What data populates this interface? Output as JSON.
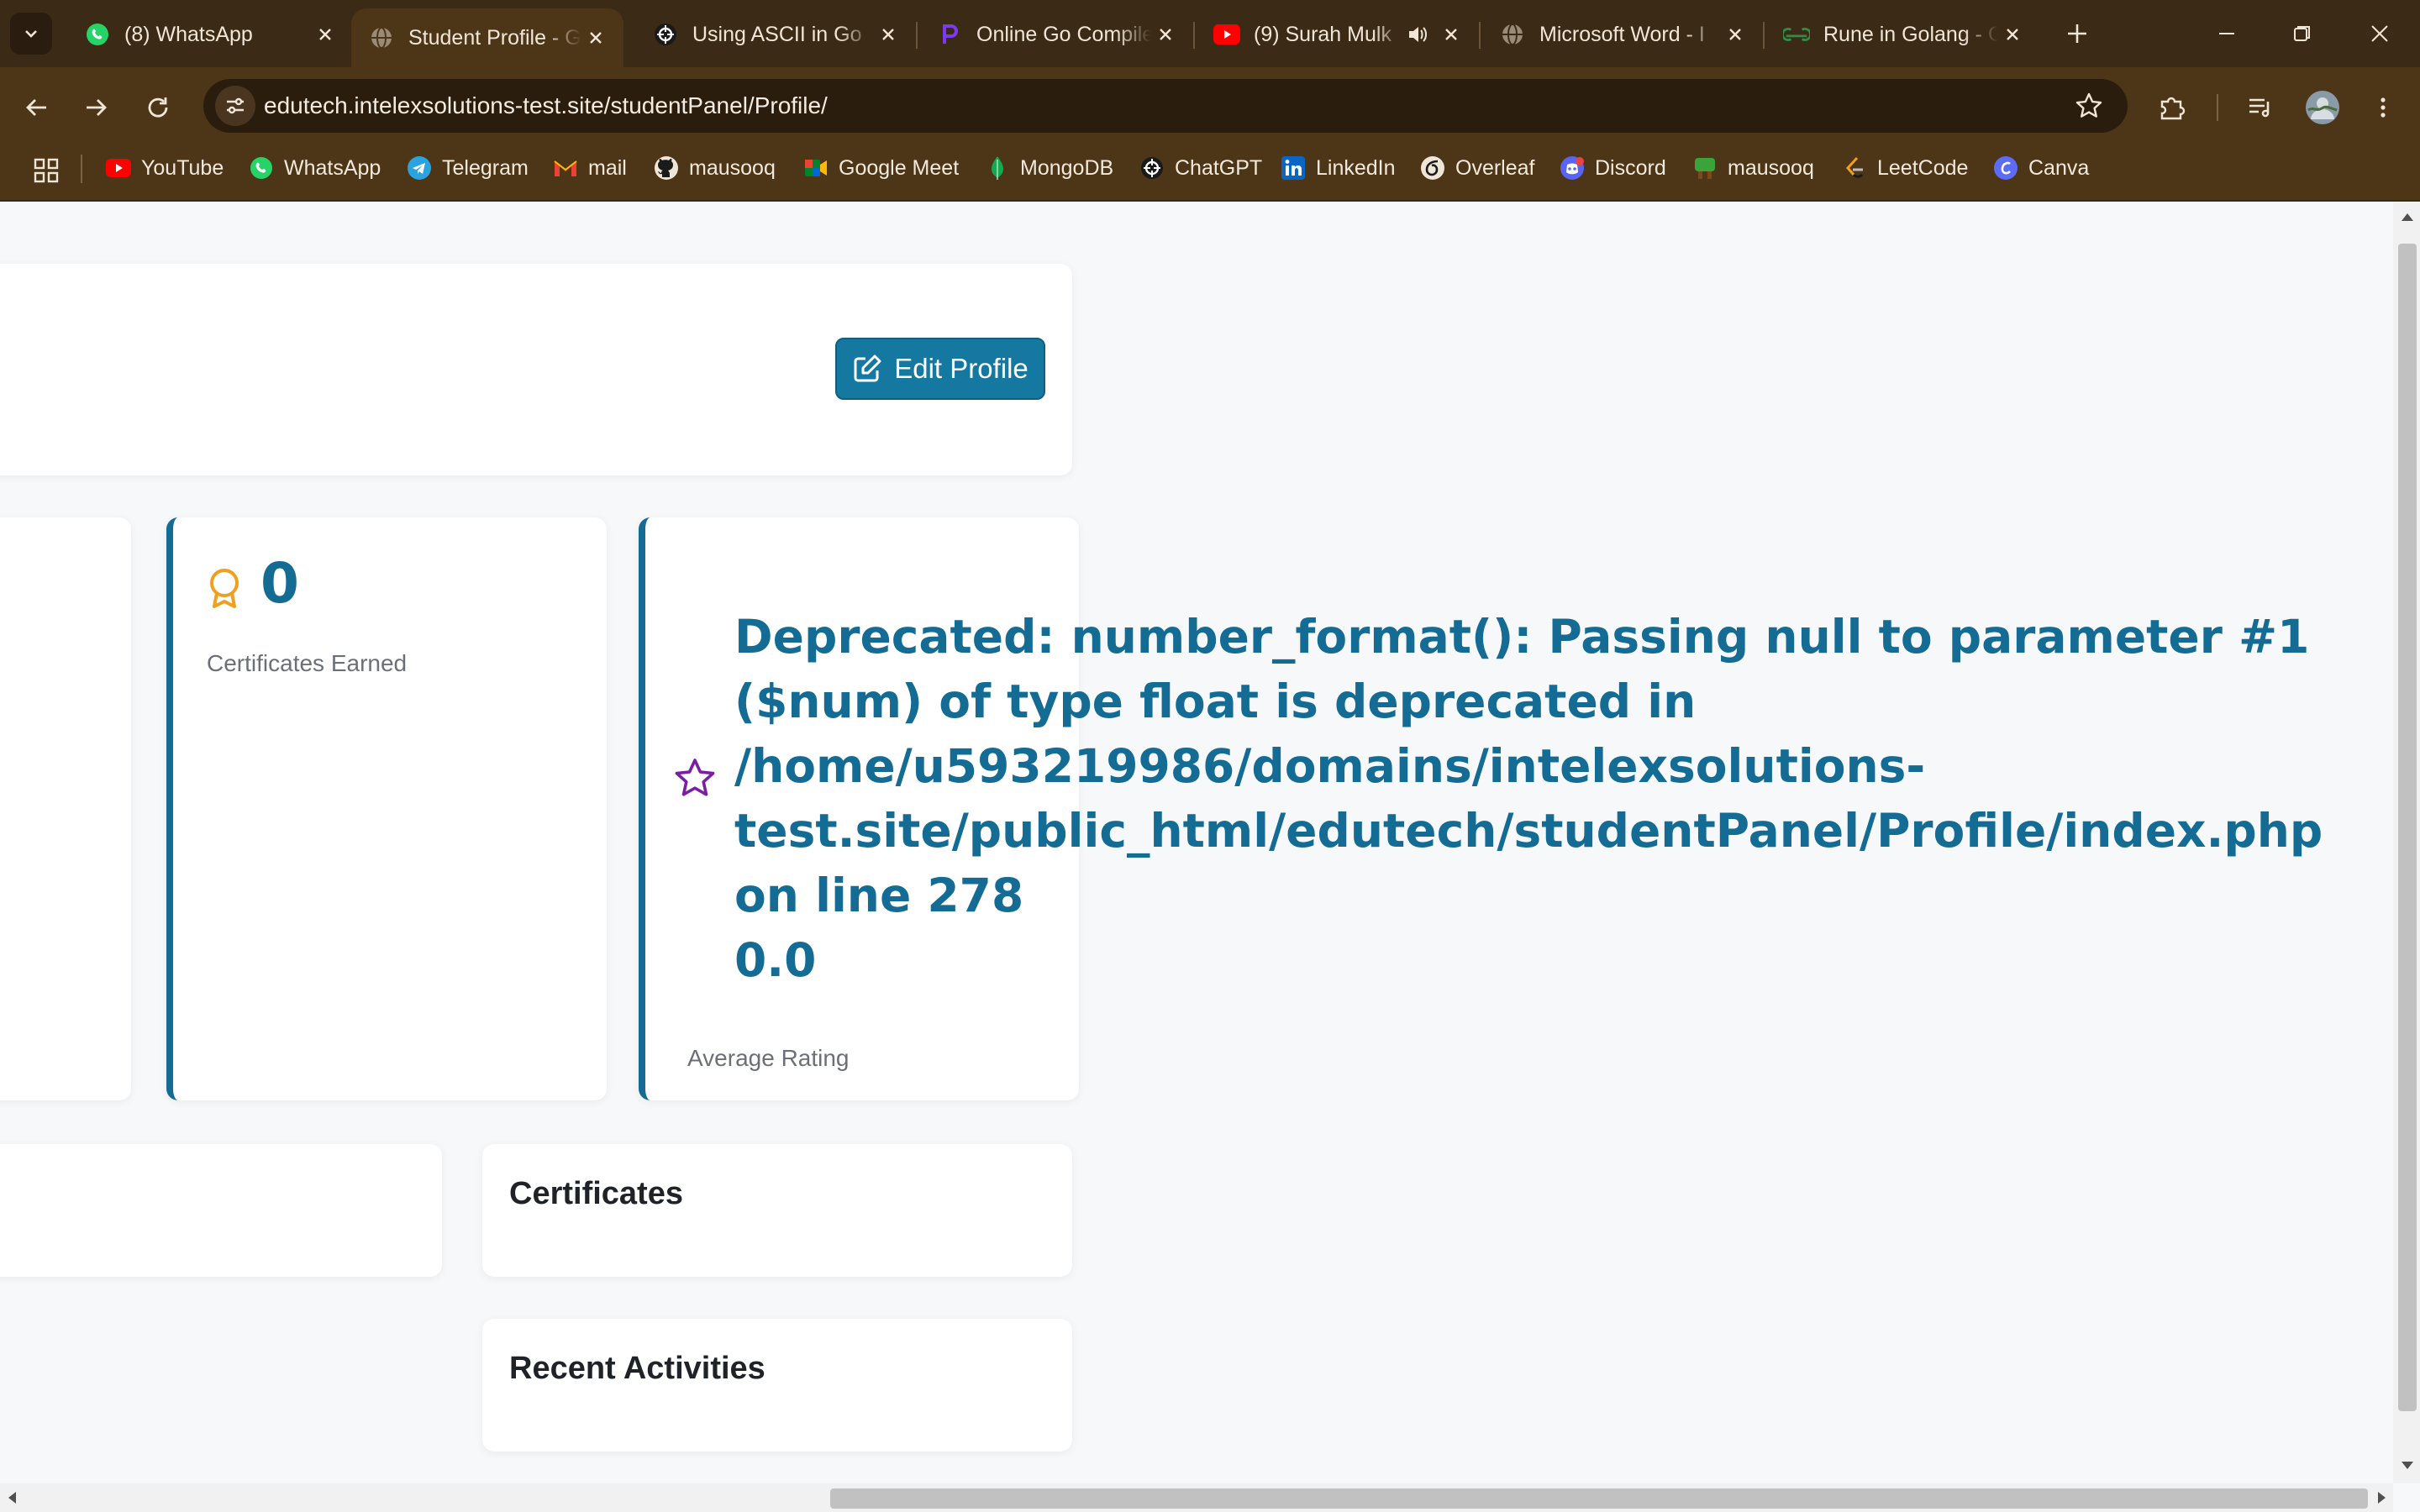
{
  "browser": {
    "tabs": [
      {
        "title": "(8) WhatsApp",
        "icon": "whatsapp-icon",
        "active": false
      },
      {
        "title": "Student Profile - G",
        "icon": "globe-icon",
        "active": true
      },
      {
        "title": "Using ASCII in Go",
        "icon": "chatgpt-icon",
        "active": false
      },
      {
        "title": "Online Go Compile",
        "icon": "programiz-icon",
        "active": false
      },
      {
        "title": "(9) Surah Mulk",
        "icon": "youtube-icon",
        "active": false
      },
      {
        "title": "Microsoft Word - I",
        "icon": "globe-icon",
        "active": false
      },
      {
        "title": "Rune in Golang - G",
        "icon": "geeksforgeeks-icon",
        "active": false
      }
    ],
    "url": "edutech.intelexsolutions-test.site/studentPanel/Profile/",
    "bookmarks": [
      {
        "label": "YouTube",
        "icon": "youtube-icon"
      },
      {
        "label": "WhatsApp",
        "icon": "whatsapp-icon"
      },
      {
        "label": "Telegram",
        "icon": "telegram-icon"
      },
      {
        "label": "mail",
        "icon": "gmail-icon"
      },
      {
        "label": "mausooq",
        "icon": "github-icon"
      },
      {
        "label": "Google Meet",
        "icon": "google-meet-icon"
      },
      {
        "label": "MongoDB",
        "icon": "mongodb-icon"
      },
      {
        "label": "ChatGPT",
        "icon": "chatgpt-icon"
      },
      {
        "label": "LinkedIn",
        "icon": "linkedin-icon"
      },
      {
        "label": "Overleaf",
        "icon": "overleaf-icon"
      },
      {
        "label": "Discord",
        "icon": "discord-icon"
      },
      {
        "label": "mausooq",
        "icon": "tree-icon"
      },
      {
        "label": "LeetCode",
        "icon": "leetcode-icon"
      },
      {
        "label": "Canva",
        "icon": "canva-icon"
      }
    ]
  },
  "page": {
    "edit_profile_label": "Edit Profile",
    "certificates": {
      "value": "0",
      "label": "Certificates Earned"
    },
    "rating": {
      "deprecation_label": "Deprecated",
      "deprecation_lines": [
        ": number_format(): Passing null to parameter #1",
        "($num) of type float is deprecated in",
        "/home/u593219986/domains/intelexsolutions-",
        "test.site/public_html/edutech/studentPanel/Profile/index.php",
        "on line 278"
      ],
      "value": "0.0",
      "label": "Average Rating"
    },
    "sections": {
      "certificates_title": "Certificates",
      "recent_activities_title": "Recent Activities"
    }
  },
  "colors": {
    "accent": "#146b93",
    "button": "#1478a1",
    "award_icon": "#f0a020",
    "star_icon": "#7b1fa2",
    "browser_frame": "#4d3518"
  }
}
